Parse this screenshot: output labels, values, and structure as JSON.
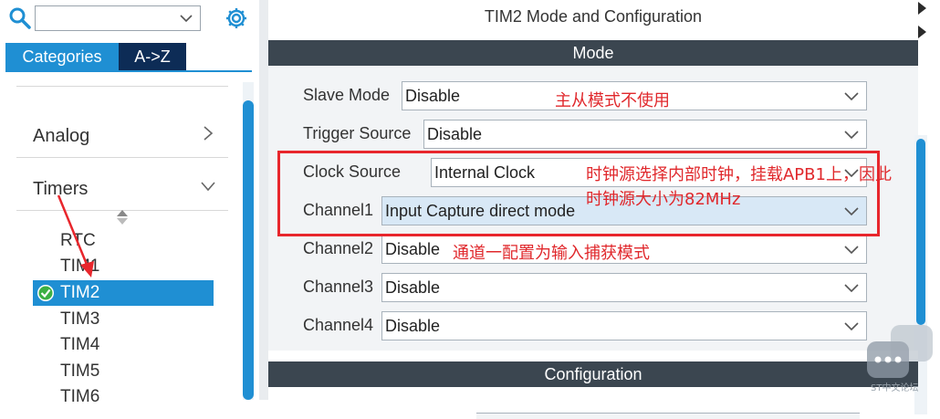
{
  "left_panel": {
    "search": {
      "value": "",
      "placeholder": ""
    },
    "tabs": [
      {
        "label": "Categories"
      },
      {
        "label": "A->Z"
      }
    ],
    "categories": [
      {
        "label": "Analog"
      },
      {
        "label": "Timers"
      }
    ],
    "items": [
      {
        "label": "RTC"
      },
      {
        "label": "TIM1"
      },
      {
        "label": "TIM2"
      },
      {
        "label": "TIM3"
      },
      {
        "label": "TIM4"
      },
      {
        "label": "TIM5"
      },
      {
        "label": "TIM6"
      }
    ],
    "selected_item": "TIM2"
  },
  "right_panel": {
    "title": "TIM2 Mode and Configuration",
    "mode_header": "Mode",
    "config_header": "Configuration",
    "rows": [
      {
        "label": "Slave Mode",
        "value": "Disable"
      },
      {
        "label": "Trigger Source",
        "value": "Disable"
      },
      {
        "label": "Clock Source",
        "value": "Internal Clock"
      },
      {
        "label": "Channel1",
        "value": "Input Capture direct mode"
      },
      {
        "label": "Channel2",
        "value": "Disable"
      },
      {
        "label": "Channel3",
        "value": "Disable"
      },
      {
        "label": "Channel4",
        "value": "Disable"
      }
    ]
  },
  "annotations": {
    "slave_note": "主从模式不使用",
    "clock_note_line1": "时钟源选择内部时钟，挂载APB1上，因此",
    "clock_note_line2": "时钟源大小为82MHz",
    "channel_note": "通道一配置为输入捕获模式"
  },
  "watermark": {
    "text": "ST中文论坛"
  },
  "colors": {
    "accent": "#1f8fd3",
    "tab_dark": "#0d2c56",
    "section_header": "#3b4650",
    "annotation_red": "#e8262c",
    "selected_check": "#3cb043"
  }
}
